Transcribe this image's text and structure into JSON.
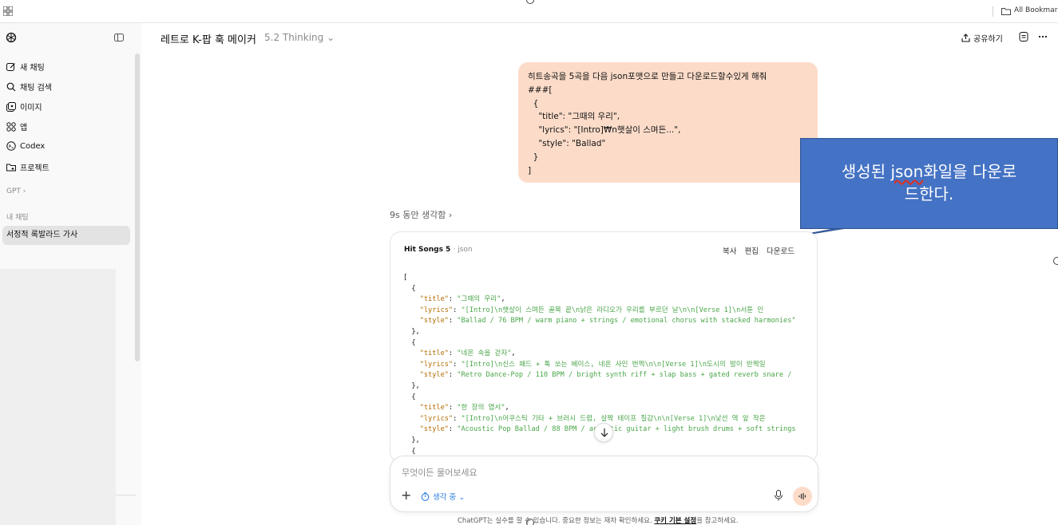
{
  "bookmarks": {
    "all_label": "All Bookmarks"
  },
  "sidebar": {
    "new_chat": "새 채팅",
    "search": "채팅 검색",
    "images": "이미지",
    "apps": "앱",
    "codex": "Codex",
    "projects": "프로젝트",
    "gpt_label": "GPT ›",
    "my_chats_label": "내 채팅",
    "chats": [
      "서정적 록발라드 가사"
    ]
  },
  "header": {
    "title": "레트로 K-팝 훅 메이커",
    "model": "5.2 Thinking ⌄",
    "share": "공유하기"
  },
  "user_message": "히트송곡을 5곡을 다음 json포맷으로 만들고 다운로드할수있게 해줘\n###[\n  {\n    \"title\": \"그때의 우리\",\n    \"lyrics\": \"[Intro]₩n햇살이 스며든...\",\n    \"style\": \"Ballad\"\n  }\n]",
  "callout": {
    "word": "json",
    "line1_pre": "생성된 ",
    "line1_post": "화일을 다운로",
    "line2": "드한다."
  },
  "thinking_label": "9s 동안 생각함 ›",
  "code_card": {
    "title": "Hit Songs 5",
    "ext": "· json",
    "actions": [
      "복사",
      "편집",
      "다운로드"
    ],
    "songs": [
      {
        "title": "\"그때의 우리\"",
        "lyrics": "\"[Intro]\\n햇살이 스며든 골목 끝\\n낡은 라디오가 우리를 부르던 날\\n\\n[Verse 1]\\n서툰 인",
        "style": "\"Ballad / 76 BPM / warm piano + strings / emotional chorus with stacked harmonies\""
      },
      {
        "title": "\"네온 속을 걷자\"",
        "lyrics": "\"[Intro]\\n신스 패드 + 톡 쏘는 베이스, 네온 사인 번쩍\\n\\n[Verse 1]\\n도시의 밤이 반짝일",
        "style": "\"Retro Dance-Pop / 110 BPM / bright synth riff + slap bass + gated reverb snare /"
      },
      {
        "title": "\"한 장의 엽서\"",
        "lyrics": "\"[Intro]\\n어쿠스틱 기타 + 브러시 드럼, 살짝 테이프 질감\\n\\n[Verse 1]\\n낯선 역 앞 작은",
        "style": "\"Acoustic Pop Ballad / 88 BPM / acoustic guitar + light brush drums + soft strings"
      }
    ]
  },
  "composer": {
    "placeholder": "무엇이든 물어보세요",
    "thinking_pill": "생각 중 ⌄"
  },
  "footer": {
    "note_pre": "ChatGPT는 실수를 할 수 있습니다. 중요한 정보는 재차 확인하세요. ",
    "note_link": "쿠키 기본 설정",
    "note_post": "을 참고하세요."
  }
}
